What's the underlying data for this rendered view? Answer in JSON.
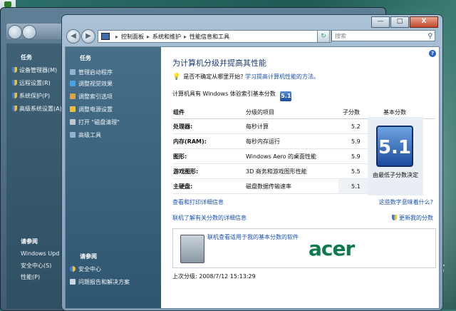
{
  "background_window": {
    "tasks_header": "任务",
    "tasks": [
      {
        "label": "设备管理器(M)"
      },
      {
        "label": "远程设置(R)"
      },
      {
        "label": "系统保护(P)"
      },
      {
        "label": "高级系统设置(A)"
      }
    ],
    "see_also_header": "请参阅",
    "see_also": [
      {
        "label": "Windows Upd"
      },
      {
        "label": "安全中心(S)"
      },
      {
        "label": "性能(P)"
      }
    ]
  },
  "window": {
    "minimize_label": "—",
    "maximize_label": "□",
    "close_label": "X"
  },
  "address_bar": {
    "crumbs": [
      "控制面板",
      "系统和维护",
      "性能信息和工具"
    ],
    "search_placeholder": "搜索"
  },
  "sidebar": {
    "tasks_header": "任务",
    "items": [
      {
        "label": "管理启动程序",
        "icon": "startup-icon",
        "color": "#8fb3d1"
      },
      {
        "label": "调整视觉效果",
        "icon": "visual-effects-icon",
        "color": "#4aa0e0"
      },
      {
        "label": "调整索引选项",
        "icon": "index-icon",
        "color": "#d6a24a"
      },
      {
        "label": "调整电源设置",
        "icon": "power-icon",
        "color": "#e8c23b"
      },
      {
        "label": "打开 \"磁盘清理\"",
        "icon": "disk-cleanup-icon",
        "color": "#bfc8d0"
      },
      {
        "label": "高级工具",
        "icon": "tools-icon",
        "color": "#8fb3d1"
      }
    ],
    "see_also_header": "请参阅",
    "see_also": [
      {
        "label": "安全中心",
        "icon": "security-center-icon"
      },
      {
        "label": "问题报告和解决方案",
        "icon": "problem-reports-icon"
      }
    ]
  },
  "main": {
    "title": "为计算机分级并提高其性能",
    "tip_text": "是否不确定从哪里开始?",
    "tip_link": "学习提高计算机性能的方法。",
    "base_score_text": "计算机具有 Windows 体验索引基本分数",
    "base_score": "5.1",
    "table": {
      "headers": [
        "组件",
        "分级的项目",
        "子分数",
        "基本分数"
      ],
      "rows": [
        {
          "component": "处理器:",
          "item": "每秒计算",
          "score": "5.2"
        },
        {
          "component": "内存(RAM):",
          "item": "每秒内存运行",
          "score": "5.9"
        },
        {
          "component": "图形:",
          "item": "Windows Aero 的桌面性能",
          "score": "5.9"
        },
        {
          "component": "游戏图形:",
          "item": "3D 商务和游戏图形性能",
          "score": "5.5"
        },
        {
          "component": "主硬盘:",
          "item": "磁盘数据传输速率",
          "score": "5.1"
        }
      ],
      "base_score_caption": "由最低子分数决定"
    },
    "link_details": "查看和打印详细信息",
    "link_meaning": "这些数字意味着什么?",
    "link_online": "联机了解有关分数的详细信息",
    "link_update": "更新我的分数",
    "promo_text": "联机查看适用于我的基本分数的软件",
    "promo_brand": "acer",
    "last_rated": "上次分级: 2008/7/12 15:13:29"
  }
}
